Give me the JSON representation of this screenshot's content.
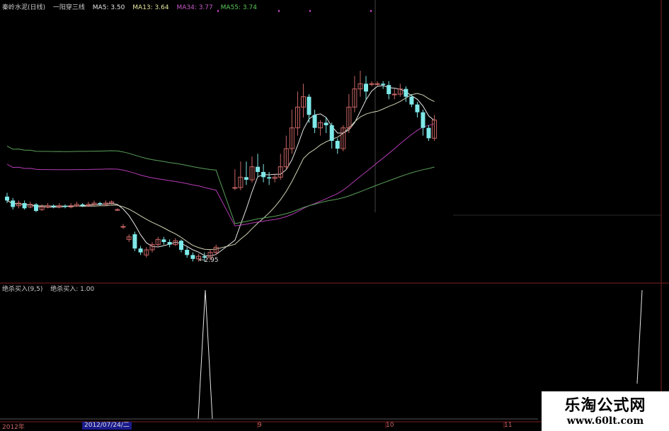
{
  "header": {
    "stock_name": "秦岭水泥(日线)",
    "formula_name": "一阳穿三线",
    "ma5": "MA5: 3.50",
    "ma13": "MA13: 3.64",
    "ma34": "MA34: 3.77",
    "ma55": "MA55: 3.74"
  },
  "indicator": {
    "name": "绝杀买入(9,5)",
    "value": "绝杀买入: 1.00"
  },
  "axis": {
    "year": "2012年",
    "selected_date": "2012/07/24/二",
    "month_9": "9",
    "month_10": "10",
    "month_11": "11"
  },
  "low_marker": "←2.95",
  "watermark": {
    "line1": "乐淘公式网",
    "line2": "www.60lt.com"
  },
  "colors": {
    "up": "#c86464",
    "down": "#7fe8e8",
    "ma5": "#e6e6e6",
    "ma13": "#d2d2b4",
    "ma34": "#b43cb4",
    "ma55": "#5aa05a",
    "grid": "#7a1f1f"
  },
  "chart_data": {
    "type": "candlestick",
    "candles": [
      [
        3.03,
        3.0,
        3.06,
        2.98
      ],
      [
        3.0,
        2.95,
        3.02,
        2.93
      ],
      [
        2.96,
        2.98,
        3.0,
        2.94
      ],
      [
        2.98,
        2.94,
        3.0,
        2.93
      ],
      [
        2.95,
        2.97,
        2.99,
        2.94
      ],
      [
        2.97,
        2.92,
        2.98,
        2.91
      ],
      [
        2.93,
        2.95,
        2.97,
        2.92
      ],
      [
        2.95,
        2.96,
        2.98,
        2.94
      ],
      [
        2.96,
        2.95,
        2.97,
        2.94
      ],
      [
        2.95,
        2.96,
        2.98,
        2.94
      ],
      [
        2.96,
        2.95,
        2.97,
        2.94
      ],
      [
        2.95,
        2.96,
        2.98,
        2.94
      ],
      [
        2.96,
        2.97,
        2.99,
        2.95
      ],
      [
        2.97,
        2.96,
        2.98,
        2.95
      ],
      [
        2.96,
        2.97,
        2.99,
        2.95
      ],
      [
        2.97,
        2.98,
        3.0,
        2.96
      ],
      [
        2.98,
        2.97,
        2.99,
        2.96
      ],
      [
        2.97,
        2.98,
        3.0,
        2.96
      ],
      [
        2.98,
        2.99,
        3.0,
        2.97
      ],
      [
        2.93,
        2.93,
        2.94,
        2.92
      ],
      [
        2.8,
        2.8,
        2.82,
        2.78
      ],
      [
        2.7,
        2.72,
        2.74,
        2.68
      ],
      [
        2.74,
        2.63,
        2.76,
        2.61
      ],
      [
        2.63,
        2.6,
        2.65,
        2.58
      ],
      [
        2.58,
        2.62,
        2.64,
        2.56
      ],
      [
        2.62,
        2.66,
        2.68,
        2.6
      ],
      [
        2.66,
        2.7,
        2.72,
        2.64
      ],
      [
        2.7,
        2.68,
        2.72,
        2.66
      ],
      [
        2.68,
        2.66,
        2.7,
        2.64
      ],
      [
        2.66,
        2.69,
        2.71,
        2.65
      ],
      [
        2.69,
        2.62,
        2.7,
        2.6
      ],
      [
        2.62,
        2.58,
        2.64,
        2.56
      ],
      [
        2.58,
        2.55,
        2.6,
        2.53
      ],
      [
        2.55,
        2.57,
        2.59,
        2.53
      ],
      [
        2.57,
        2.56,
        2.6,
        2.53
      ],
      [
        2.56,
        2.6,
        2.62,
        2.54
      ],
      [
        2.6,
        2.64,
        2.66,
        2.58
      ],
      [
        3.1,
        3.1,
        3.24,
        3.08
      ],
      [
        3.1,
        3.18,
        3.3,
        3.08
      ],
      [
        3.18,
        3.16,
        3.3,
        3.12
      ],
      [
        3.16,
        3.26,
        3.34,
        3.14
      ],
      [
        3.26,
        3.22,
        3.36,
        3.18
      ],
      [
        3.22,
        3.18,
        3.28,
        3.14
      ],
      [
        3.18,
        3.17,
        3.22,
        3.12
      ],
      [
        3.17,
        3.18,
        3.2,
        3.14
      ],
      [
        3.18,
        3.26,
        3.36,
        3.16
      ],
      [
        3.26,
        3.4,
        3.5,
        3.24
      ],
      [
        3.4,
        3.56,
        3.7,
        3.36
      ],
      [
        3.56,
        3.72,
        3.84,
        3.5
      ],
      [
        3.72,
        3.8,
        3.9,
        3.64
      ],
      [
        3.8,
        3.66,
        3.82,
        3.6
      ],
      [
        3.66,
        3.56,
        3.7,
        3.52
      ],
      [
        3.56,
        3.6,
        3.62,
        3.5
      ],
      [
        3.6,
        3.58,
        3.64,
        3.52
      ],
      [
        3.58,
        3.46,
        3.6,
        3.4
      ],
      [
        3.46,
        3.4,
        3.48,
        3.36
      ],
      [
        3.4,
        3.56,
        3.58,
        3.38
      ],
      [
        3.56,
        3.72,
        3.82,
        3.52
      ],
      [
        3.72,
        3.86,
        3.96,
        3.68
      ],
      [
        3.86,
        3.9,
        4.0,
        3.8
      ],
      [
        3.9,
        3.84,
        3.96,
        3.78
      ],
      [
        3.9,
        3.9,
        3.92,
        3.88
      ],
      [
        3.9,
        3.9,
        3.92,
        3.88
      ],
      [
        3.9,
        3.89,
        3.92,
        3.86
      ],
      [
        3.89,
        3.82,
        3.92,
        3.78
      ],
      [
        3.82,
        3.82,
        3.86,
        3.78
      ],
      [
        3.82,
        3.86,
        3.9,
        3.8
      ],
      [
        3.86,
        3.8,
        3.88,
        3.76
      ],
      [
        3.8,
        3.74,
        3.82,
        3.72
      ],
      [
        3.74,
        3.68,
        3.76,
        3.64
      ],
      [
        3.68,
        3.56,
        3.7,
        3.5
      ],
      [
        3.56,
        3.48,
        3.58,
        3.46
      ],
      [
        3.48,
        3.62,
        3.66,
        3.46
      ]
    ],
    "signal_indexes": [
      37,
      72
    ]
  }
}
